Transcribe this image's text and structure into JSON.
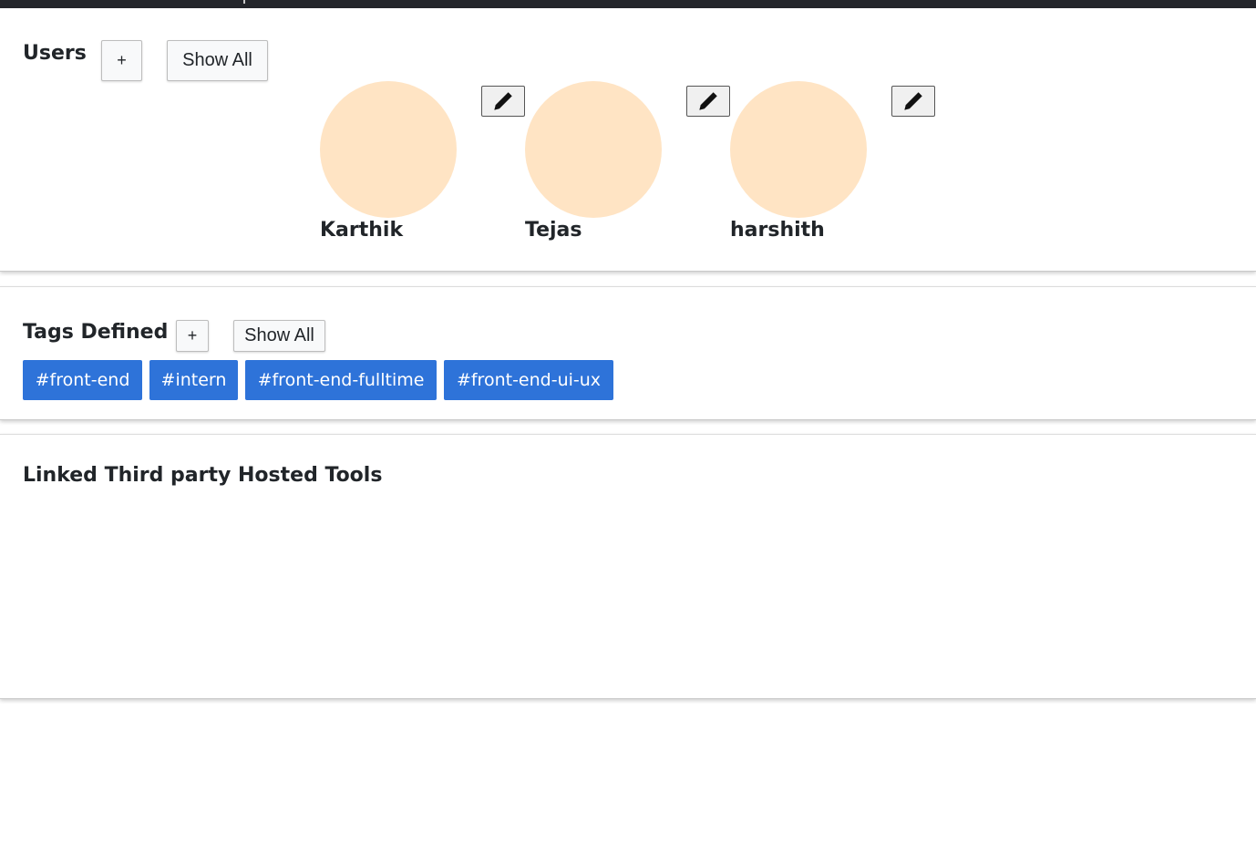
{
  "users_section": {
    "title": "Users",
    "add_label": "+",
    "show_all_label": "Show All",
    "users": [
      {
        "name": "Karthik"
      },
      {
        "name": "Tejas"
      },
      {
        "name": "harshith"
      }
    ],
    "avatar_color": "#ffe4c4"
  },
  "tags_section": {
    "title": "Tags Defined",
    "add_label": "+",
    "show_all_label": "Show All",
    "tags": [
      "#front-end",
      "#intern",
      "#front-end-fulltime",
      "#front-end-ui-ux"
    ],
    "tag_color": "#2e73d9"
  },
  "tools_section": {
    "title": "Linked Third party Hosted Tools"
  },
  "icons": {
    "edit": "pencil-icon"
  }
}
